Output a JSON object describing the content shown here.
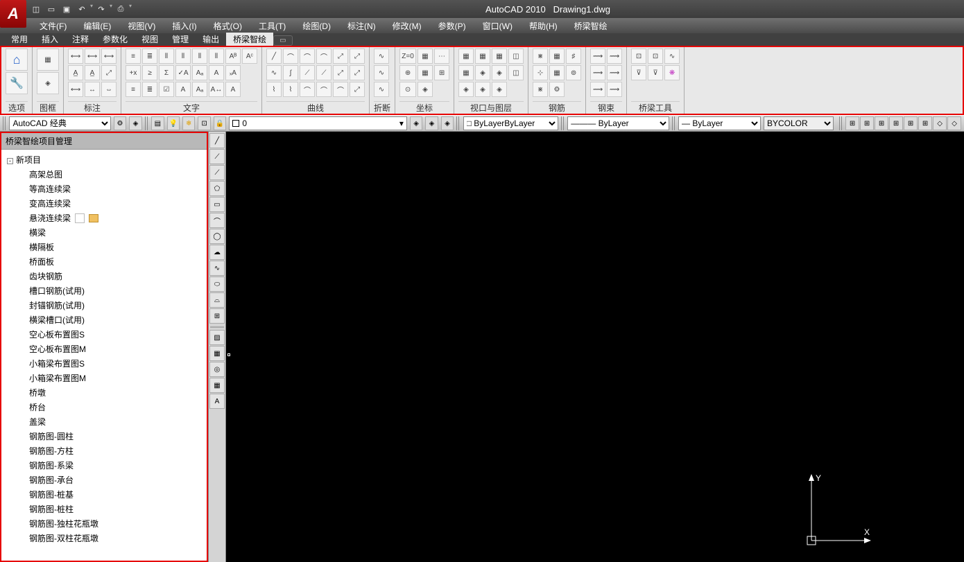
{
  "title": {
    "app": "AutoCAD 2010",
    "file": "Drawing1.dwg"
  },
  "menubar": [
    "文件(F)",
    "编辑(E)",
    "视图(V)",
    "插入(I)",
    "格式(O)",
    "工具(T)",
    "绘图(D)",
    "标注(N)",
    "修改(M)",
    "参数(P)",
    "窗口(W)",
    "帮助(H)",
    "桥梁智绘"
  ],
  "ribbon_tabs": [
    "常用",
    "插入",
    "注释",
    "参数化",
    "视图",
    "管理",
    "输出",
    "桥梁智绘"
  ],
  "ribbon_active": "桥梁智绘",
  "panels": {
    "options": "选项",
    "frame": "图框",
    "dim": "标注",
    "text": "文字",
    "curve": "曲线",
    "break": "折断",
    "coord": "坐标",
    "viewport": "视口与图层",
    "rebar": "钢筋",
    "tendon": "钢束",
    "bridge": "桥梁工具"
  },
  "workspace": "AutoCAD 经典",
  "layer_current": "0",
  "linetype": "ByLayer",
  "lineweight": "ByLayer",
  "color": "ByLayer",
  "plotstyle": "BYCOLOR",
  "sidebar_title": "桥梁智绘项目管理",
  "tree": {
    "root": "新项目",
    "children": [
      "高架总图",
      "等高连续梁",
      "变高连续梁",
      "悬浇连续梁",
      "横梁",
      "横隔板",
      "桥面板",
      "齿块钢筋",
      "槽口钢筋(试用)",
      "封锚钢筋(试用)",
      "横梁槽口(试用)",
      "空心板布置图S",
      "空心板布置图M",
      "小箱梁布置图S",
      "小箱梁布置图M",
      "桥墩",
      "桥台",
      "盖梁",
      "钢筋图-圆柱",
      "钢筋图-方柱",
      "钢筋图-系梁",
      "钢筋图-承台",
      "钢筋图-桩基",
      "钢筋图-桩柱",
      "钢筋图-独柱花瓶墩",
      "钢筋图-双柱花瓶墩"
    ]
  },
  "ucs": {
    "x": "X",
    "y": "Y"
  }
}
